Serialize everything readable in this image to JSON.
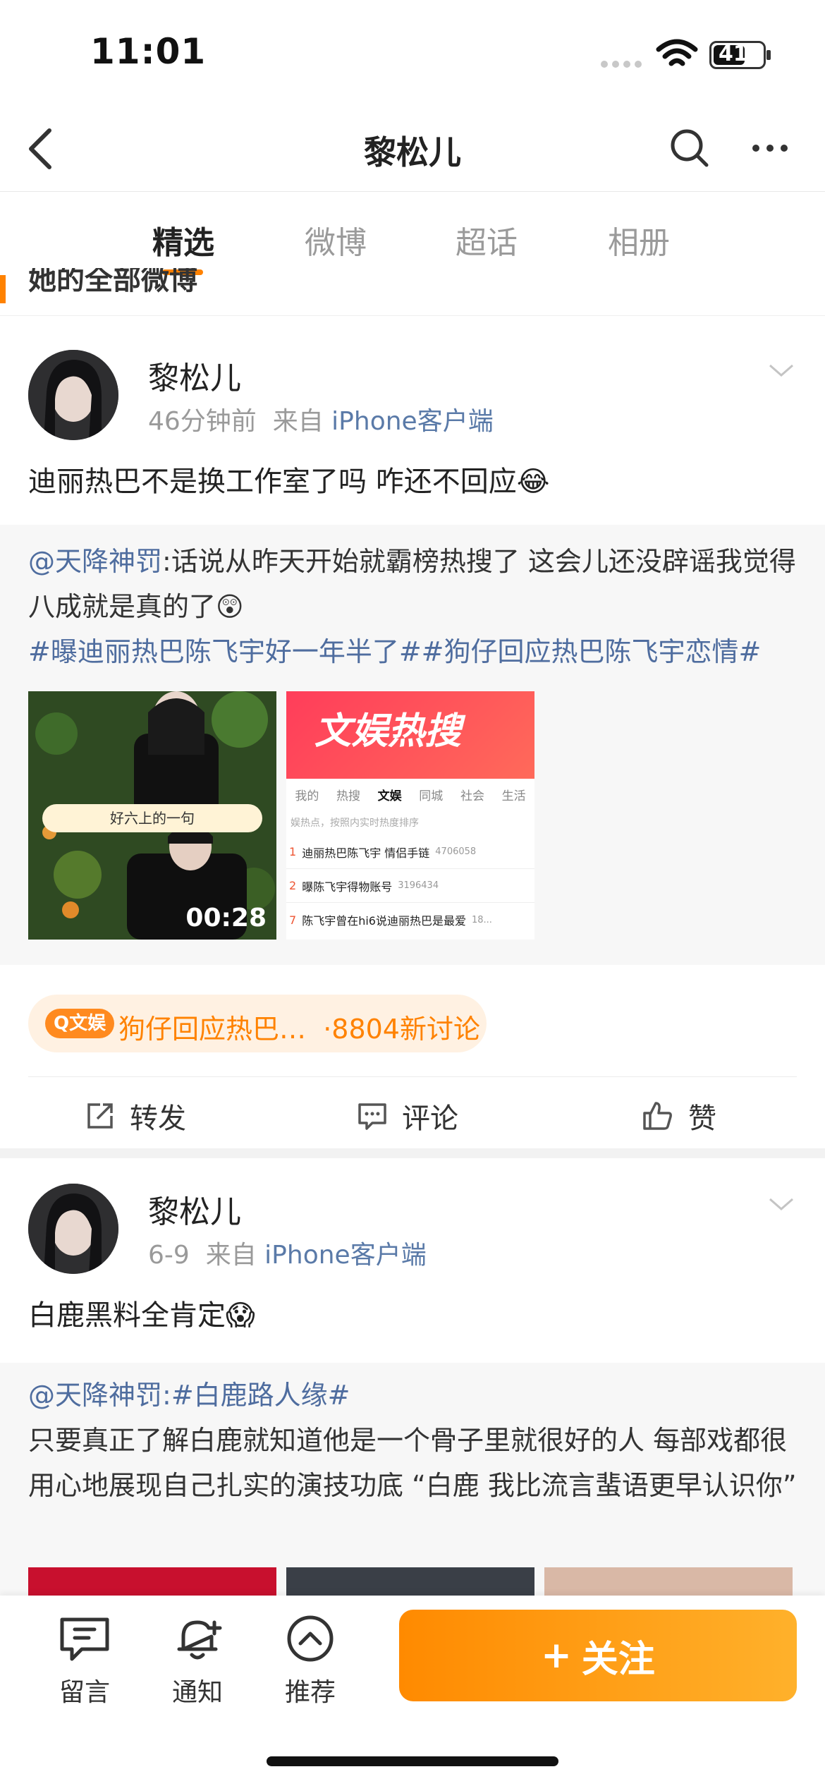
{
  "status": {
    "time": "11:01",
    "battery": "41"
  },
  "nav": {
    "title": "黎松儿"
  },
  "tabs": [
    "精选",
    "微博",
    "超话",
    "相册"
  ],
  "peek_text": "她的全部微博",
  "posts": [
    {
      "user": "黎松儿",
      "time": "46分钟前",
      "from_prefix": "来自",
      "source": "iPhone客户端",
      "text": "迪丽热巴不是换工作室了吗 咋还不回应😂",
      "repost": {
        "mention": "@天降神罚",
        "body": ":话说从昨天开始就霸榜热搜了 这会儿还没辟谣我觉得八成就是真的了😲",
        "tags": "#曝迪丽热巴陈飞宇好一年半了##狗仔回应热巴陈飞宇恋情#",
        "video_duration": "00:28",
        "video_caption": "好六上的一句",
        "image": {
          "banner": "文娱热搜",
          "tabs": [
            "我的",
            "热搜",
            "文娱",
            "同城",
            "社会",
            "生活"
          ],
          "note": "娱热点，按照内实时热度排序",
          "rows": [
            {
              "rank": "1",
              "text": "迪丽热巴陈飞宇 情侣手链",
              "count": "4706058"
            },
            {
              "rank": "2",
              "text": "曝陈飞宇得物账号",
              "count": "3196434"
            },
            {
              "rank": "7",
              "text": "陈飞宇曾在hi6说迪丽热巴是最爱",
              "count": "18..."
            }
          ]
        }
      },
      "topic": {
        "badge": "Q文娱",
        "text": "狗仔回应热巴…",
        "count": "·8804新讨论"
      },
      "actions": {
        "repost": "转发",
        "comment": "评论",
        "like": "赞"
      }
    },
    {
      "user": "黎松儿",
      "time": "6-9",
      "from_prefix": "来自",
      "source": "iPhone客户端",
      "text": "白鹿黑料全肯定😱",
      "repost": {
        "mention": "@天降神罚",
        "tag": ":#白鹿路人缘#",
        "body": "只要真正了解白鹿就知道他是一个骨子里就很好的人 每部戏都很用心地展现自己扎实的演技功底 “白鹿 我比流言蜚语更早认识你”"
      }
    }
  ],
  "bottom": {
    "message": "留言",
    "notify": "通知",
    "recommend": "推荐",
    "follow": "关注",
    "follow_icon": "+"
  },
  "colors": {
    "accent": "#ff8200",
    "link": "#4f6d9f"
  }
}
